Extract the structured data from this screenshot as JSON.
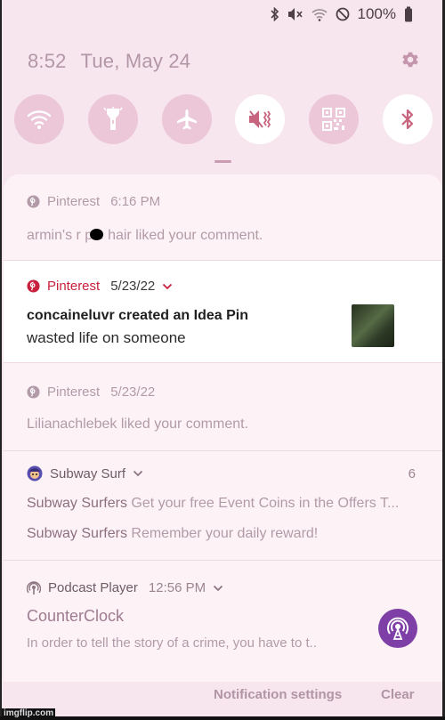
{
  "status_bar": {
    "icons": [
      "bluetooth-icon",
      "mute-icon",
      "wifi-icon",
      "do-not-disturb-icon"
    ],
    "battery": "100%"
  },
  "header": {
    "time": "8:52",
    "date": "Tue, May 24",
    "settings_icon": "gear-icon"
  },
  "quick_settings": [
    {
      "name": "wifi",
      "icon": "wifi-icon",
      "state": "on"
    },
    {
      "name": "flashlight",
      "icon": "flashlight-icon",
      "state": "on"
    },
    {
      "name": "airplane-mode",
      "icon": "airplane-icon",
      "state": "on"
    },
    {
      "name": "sound",
      "icon": "mute-icon",
      "state": "off"
    },
    {
      "name": "qr-scanner",
      "icon": "qr-code-icon",
      "state": "on"
    },
    {
      "name": "bluetooth",
      "icon": "bluetooth-icon",
      "state": "off"
    }
  ],
  "notifications": [
    {
      "app": "Pinterest",
      "time": "6:16 PM",
      "text": "armin's r ple hair liked your comment."
    },
    {
      "app": "Pinterest",
      "time": "5/23/22",
      "title": "concaineluvr created an Idea Pin",
      "text": "wasted life on someone"
    },
    {
      "app": "Pinterest",
      "time": "5/23/22",
      "text": "Lilianachlebek liked your comment."
    },
    {
      "app": "Subway Surf",
      "count": "6",
      "messages": [
        {
          "sender": "Subway Surfers",
          "text": "Get your free Event Coins in the Offers T..."
        },
        {
          "sender": "Subway Surfers",
          "text": "Remember your daily reward!"
        }
      ]
    },
    {
      "app": "Podcast Player",
      "time": "12:56 PM",
      "title": "CounterClock",
      "text": "In order to tell the story of a crime, you have to t.."
    }
  ],
  "footer": {
    "settings_label": "Notification settings",
    "clear_label": "Clear"
  },
  "watermark": "imgflip.com",
  "colors": {
    "background": "#f7e6ee",
    "qs_active": "#ecc7d8",
    "pinterest_red": "#c8203c",
    "podcast_purple": "#7e3fa7"
  }
}
